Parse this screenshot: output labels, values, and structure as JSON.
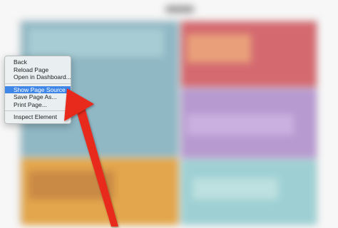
{
  "context_menu": {
    "groups": [
      {
        "items": [
          "Back",
          "Reload Page",
          "Open in Dashboard..."
        ]
      },
      {
        "items": [
          "Show Page Source",
          "Save Page As...",
          "Print Page..."
        ]
      },
      {
        "items": [
          "Inspect Element"
        ]
      }
    ],
    "selected_item": "Show Page Source"
  },
  "colors": {
    "menu_highlight": "#3e86e8",
    "arrow": "#e8291f"
  },
  "icons": {
    "annotation": "red-arrow-pointer"
  }
}
